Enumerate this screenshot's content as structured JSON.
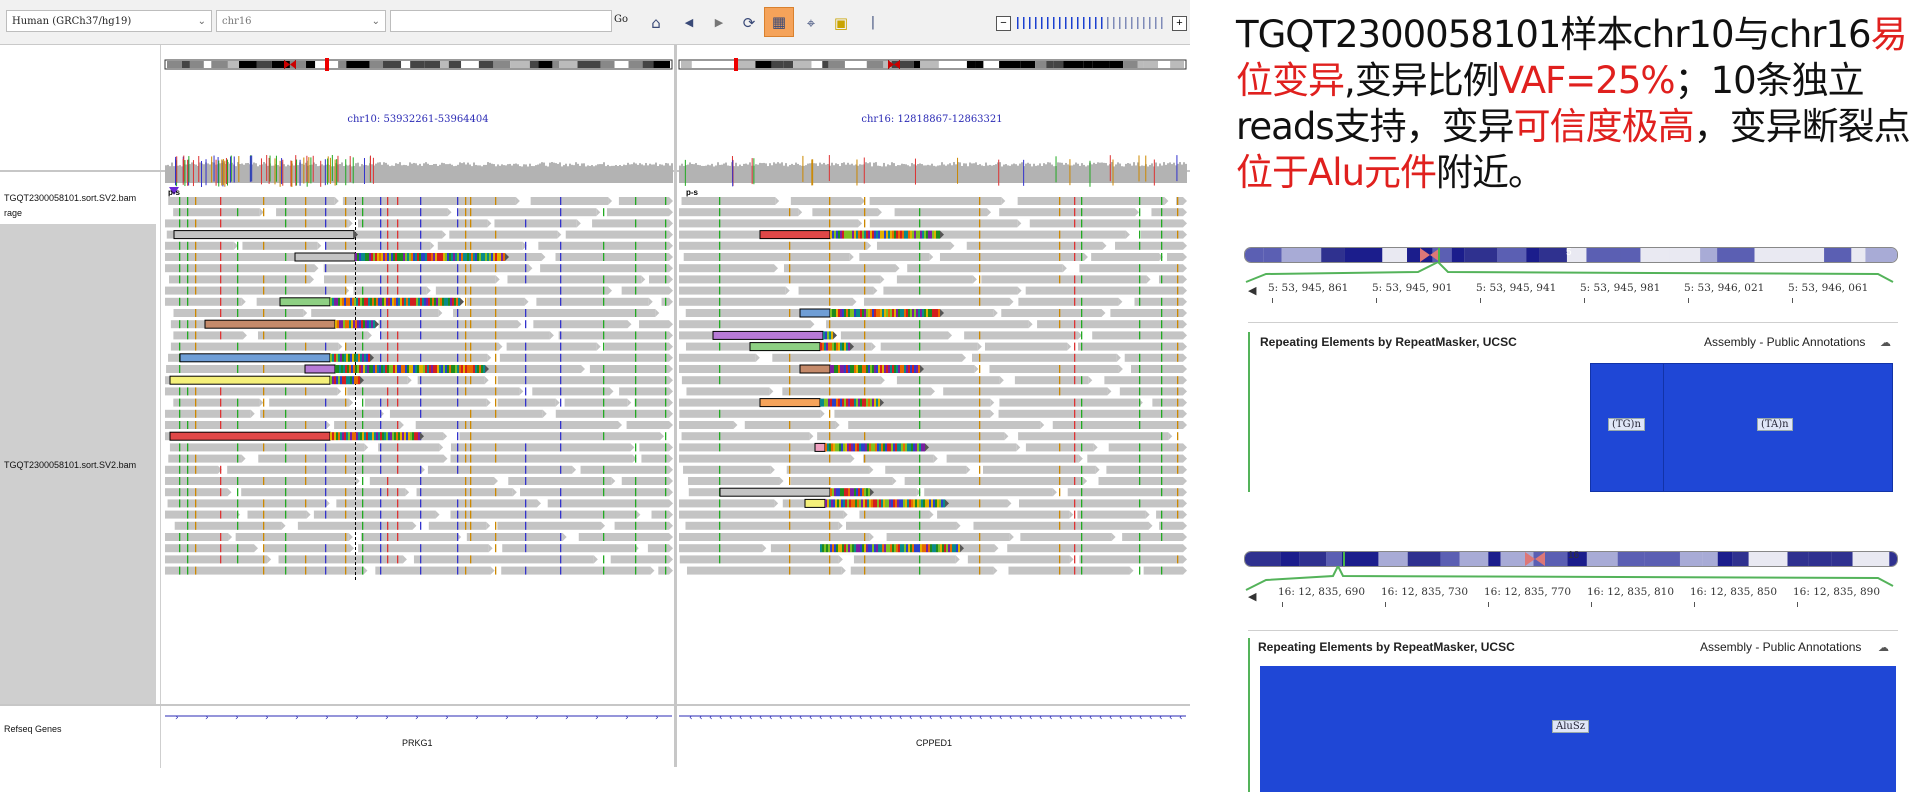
{
  "toolbar": {
    "genome": "Human (GRCh37/hg19)",
    "chromosome": "chr16",
    "locus_input": "",
    "go_label": "Go",
    "icons": [
      "home-icon",
      "back-icon",
      "forward-icon",
      "refresh-icon",
      "region-of-interest-icon",
      "resize-icon",
      "popup-text-icon",
      "ruler-icon"
    ]
  },
  "loci": {
    "left": "chr10: 53932261-53964404",
    "right": "chr16: 12818867-12863321"
  },
  "tracks": {
    "coverage_name": "TGQT2300058101.sort.SV2.bam",
    "coverage_suffix": "rage",
    "coverage_range_left": "p-s",
    "coverage_range_right": "p-s",
    "alignment_name": "TGQT2300058101.sort.SV2.bam",
    "genes_name": "Refseq Genes"
  },
  "genes": {
    "left": "PRKG1",
    "right": "CPPED1"
  },
  "description": {
    "p1": "TGQT2300058101样本chr10与chr16",
    "r1": "易位变异",
    "p2": ",变异比例",
    "r2": "VAF=25%",
    "p3": "；10条独立reads支持，变异",
    "r3": "可信度极高",
    "p4": "，变异断裂点",
    "r4": "位于Alu元件",
    "p5": "附近。"
  },
  "browser_top": {
    "ideogram_label": "5",
    "ruler": [
      "5: 53, 945, 861",
      "5: 53, 945, 901",
      "5: 53, 945, 941",
      "5: 53, 945, 981",
      "5: 53, 946, 021",
      "5: 53, 946, 061"
    ],
    "track_title": "Repeating Elements by RepeatMasker, UCSC",
    "track_source": "Assembly - Public Annotations",
    "elements": [
      "(TG)n",
      "(TA)n"
    ]
  },
  "browser_bottom": {
    "ideogram_label": "16",
    "ruler": [
      "16: 12, 835, 690",
      "16: 12, 835, 730",
      "16: 12, 835, 770",
      "16: 12, 835, 810",
      "16: 12, 835, 850",
      "16: 12, 835, 890"
    ],
    "track_title": "Repeating Elements by RepeatMasker, UCSC",
    "track_source": "Assembly - Public Annotations",
    "elements": [
      "AluSz"
    ]
  },
  "colors": {
    "highlight_red": "#e0201e",
    "repeat_blue": "#1f47d6",
    "read_grey": "#c4c4c4",
    "locus_blue": "#2b2bb5"
  }
}
